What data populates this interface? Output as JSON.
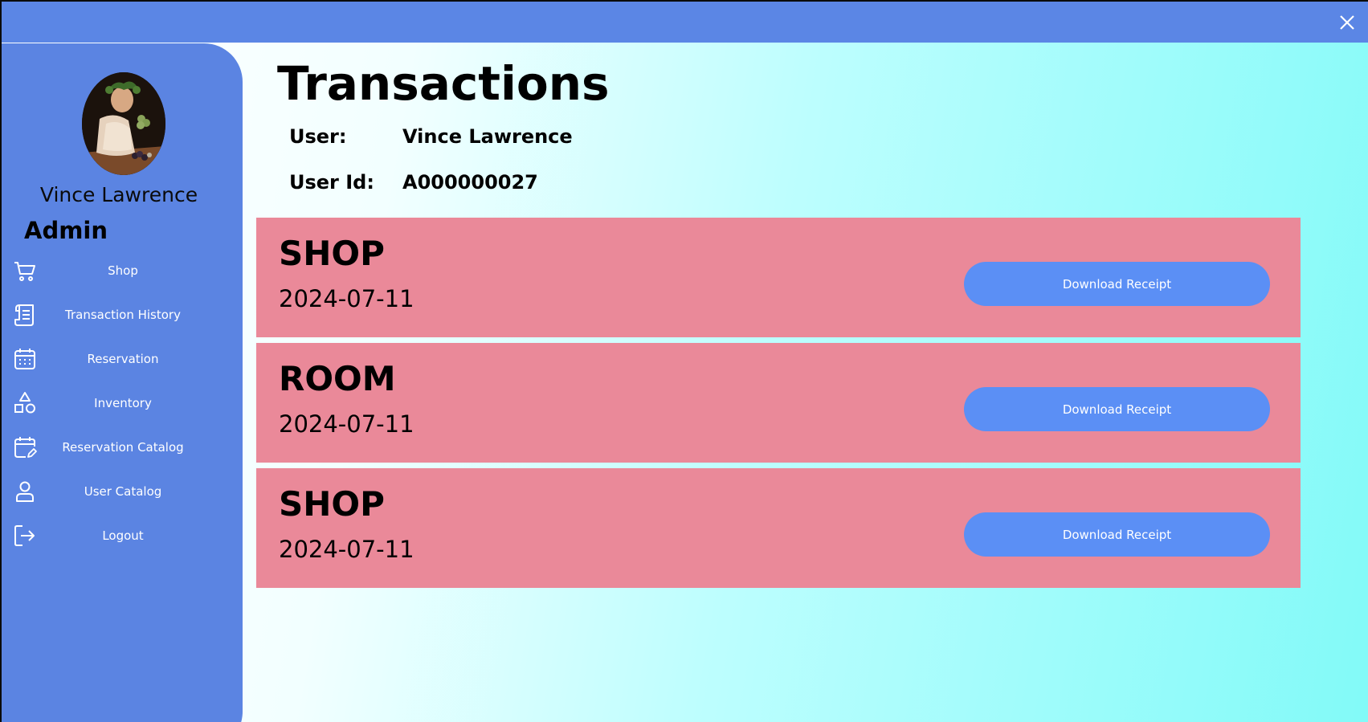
{
  "window": {
    "close_icon": "close-icon"
  },
  "sidebar": {
    "profile": {
      "name": "Vince Lawrence",
      "role": "Admin"
    },
    "items": [
      {
        "label": "Shop",
        "icon": "cart-icon"
      },
      {
        "label": "Transaction History",
        "icon": "receipt-icon"
      },
      {
        "label": "Reservation",
        "icon": "calendar-icon"
      },
      {
        "label": "Inventory",
        "icon": "shapes-icon"
      },
      {
        "label": "Reservation Catalog",
        "icon": "calendar-edit-icon"
      },
      {
        "label": "User Catalog",
        "icon": "user-icon"
      },
      {
        "label": "Logout",
        "icon": "logout-icon"
      }
    ]
  },
  "main": {
    "title": "Transactions",
    "user_label": "User:",
    "user_value": "Vince Lawrence",
    "user_id_label": "User Id:",
    "user_id_value": "A000000027",
    "transactions": [
      {
        "type": "SHOP",
        "date": "2024-07-11",
        "button": "Download Receipt"
      },
      {
        "type": "ROOM",
        "date": "2024-07-11",
        "button": "Download Receipt"
      },
      {
        "type": "SHOP",
        "date": "2024-07-11",
        "button": "Download Receipt"
      }
    ]
  },
  "colors": {
    "titlebar": "#5b86e5",
    "sidebar": "#5b84e2",
    "card": "#ea8999",
    "button": "#5b8ff5"
  }
}
